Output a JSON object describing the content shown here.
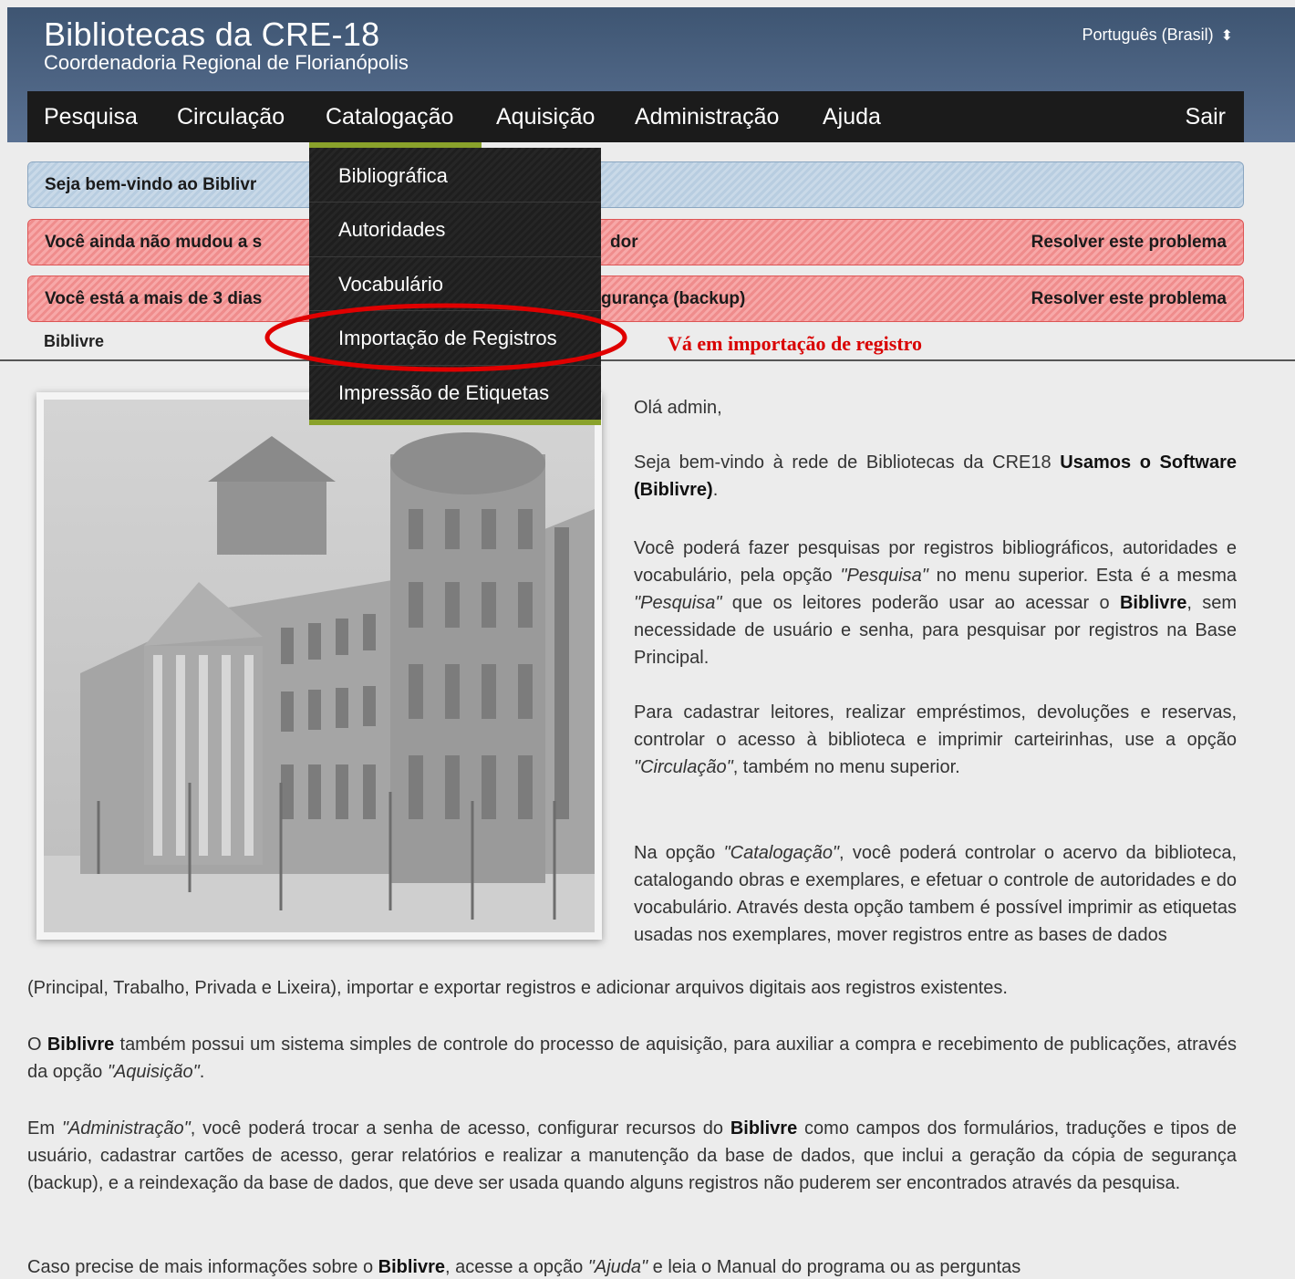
{
  "header": {
    "title": "Bibliotecas da CRE-18",
    "subtitle": "Coordenadoria Regional de Florianópolis",
    "language": "Português (Brasil)"
  },
  "menu": {
    "items": [
      "Pesquisa",
      "Circulação",
      "Catalogação",
      "Aquisição",
      "Administração",
      "Ajuda"
    ],
    "logout": "Sair",
    "active": "Catalogação"
  },
  "dropdown": {
    "items": [
      "Bibliográfica",
      "Autoridades",
      "Vocabulário",
      "Importação de Registros",
      "Impressão de Etiquetas"
    ]
  },
  "alerts": {
    "info": "Seja bem-vindo ao Biblivr",
    "password_start": "Você ainda não mudou a s",
    "password_end": "dor",
    "backup_start": "Você está a mais de 3 dias",
    "backup_end": "gurança (backup)",
    "action": "Resolver este problema"
  },
  "breadcrumb": "Biblivre",
  "annotation": "Vá em importação de registro",
  "content": {
    "greeting": "Olá admin,",
    "p1_a": "Seja bem-vindo à rede de Bibliotecas da CRE18 ",
    "p1_b": "Usamos o Software (Biblivre)",
    "p1_c": ".",
    "p2_a": "Você poderá fazer pesquisas por registros bibliográficos, autoridades e vocabulário, pela opção ",
    "p2_b": "\"Pesquisa\"",
    "p2_c": " no menu superior. Esta é a mesma ",
    "p2_d": "\"Pesquisa\"",
    "p2_e": " que os leitores poderão usar ao acessar o ",
    "p2_f": "Biblivre",
    "p2_g": ", sem necessidade de usuário e senha, para pesquisar por registros na Base Principal.",
    "p3_a": "Para cadastrar leitores, realizar empréstimos, devoluções e reservas, controlar o acesso à biblioteca e imprimir carteirinhas, use a opção ",
    "p3_b": "\"Circulação\"",
    "p3_c": ", também no menu superior.",
    "p4_a": "Na opção ",
    "p4_b": "\"Catalogação\"",
    "p4_c": ", você poderá controlar o acervo da biblioteca, catalogando obras e exemplares, e efetuar o controle de autoridades e do vocabulário. Através desta opção tambem é possível imprimir as etiquetas usadas nos exemplares, mover registros entre as bases de dados",
    "p4_d": "(Principal, Trabalho, Privada e Lixeira), importar e exportar registros e adicionar arquivos digitais aos registros existentes.",
    "p5_a": "O ",
    "p5_b": "Biblivre",
    "p5_c": " também possui um sistema simples de controle do processo de aquisição, para auxiliar a compra e recebimento de publicações, através da opção ",
    "p5_d": "\"Aquisição\"",
    "p5_e": ".",
    "p6_a": "Em ",
    "p6_b": "\"Administração\"",
    "p6_c": ", você poderá trocar a senha de acesso, configurar recursos do ",
    "p6_d": "Biblivre",
    "p6_e": " como campos dos formulários, traduções e tipos de usuário, cadastrar cartões de acesso, gerar relatórios e realizar a manutenção da base de dados, que inclui a geração da cópia de segurança (backup), e a reindexação da base de dados, que deve ser usada quando alguns registros não puderem ser encontrados através da pesquisa.",
    "p7_a": "Caso precise de mais informações sobre o ",
    "p7_b": "Biblivre",
    "p7_c": ", acesse a opção ",
    "p7_d": "\"Ajuda\"",
    "p7_e": " e leia o Manual do programa ou as perguntas"
  },
  "colors": {
    "header_top": "#3e5572",
    "menubar": "#1b1b1b",
    "accent": "#8aa22b",
    "annotation": "#d90000"
  }
}
